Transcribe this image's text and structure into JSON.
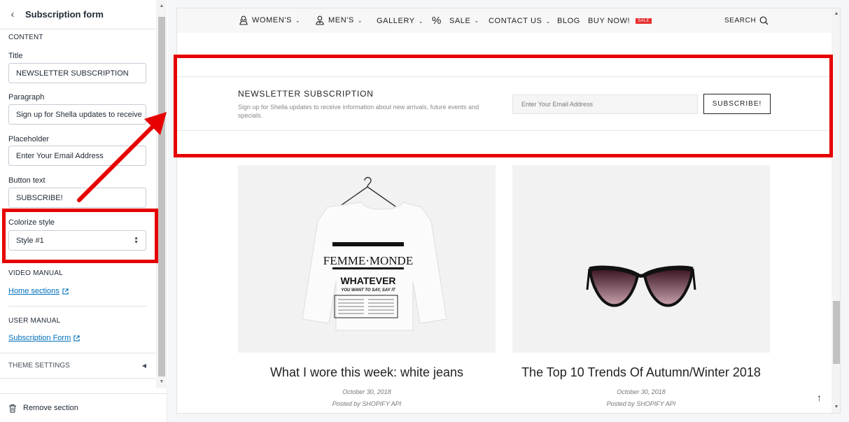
{
  "sidebar": {
    "title": "Subscription form",
    "content_heading": "CONTENT",
    "fields": {
      "title": {
        "label": "Title",
        "value": "NEWSLETTER SUBSCRIPTION"
      },
      "paragraph": {
        "label": "Paragraph",
        "value": "Sign up for Shella updates to receive"
      },
      "placeholder": {
        "label": "Placeholder",
        "value": "Enter Your Email Address"
      },
      "button_text": {
        "label": "Button text",
        "value": "SUBSCRIBE!"
      },
      "colorize": {
        "label": "Colorize style",
        "value": "Style #1"
      }
    },
    "video_manual": {
      "heading": "VIDEO MANUAL",
      "link": "Home sections"
    },
    "user_manual": {
      "heading": "USER MANUAL",
      "link": "Subscription Form"
    },
    "theme_settings": "THEME SETTINGS",
    "remove_section": "Remove section"
  },
  "preview": {
    "nav": {
      "womens": "WOMEN'S",
      "mens": "MEN'S",
      "gallery": "GALLERY",
      "sale": "SALE",
      "contact": "CONTACT US",
      "blog": "BLOG",
      "buy_now": "BUY NOW!",
      "sale_badge": "SALE",
      "search": "SEARCH"
    },
    "newsletter": {
      "title": "NEWSLETTER SUBSCRIPTION",
      "text": "Sign up for Shella updates to receive information about new arrivals, future events and specials.",
      "placeholder": "Enter Your Email Address",
      "button": "SUBSCRIBE!"
    },
    "posts": [
      {
        "title": "What I wore this week: white jeans",
        "date": "October 30, 2018",
        "author": "Posted by SHOPIFY API",
        "shirt_brand": "FEMME·MONDE",
        "shirt_slogan": "WHATEVER",
        "shirt_sub": "YOU WANT TO SAY, SAY IT"
      },
      {
        "title": "The Top 10 Trends Of Autumn/Winter 2018",
        "date": "October 30, 2018",
        "author": "Posted by SHOPIFY API"
      }
    ]
  },
  "colors": {
    "annotation": "#e60000",
    "link": "#006fbb",
    "sale_badge": "#e62e2e"
  }
}
